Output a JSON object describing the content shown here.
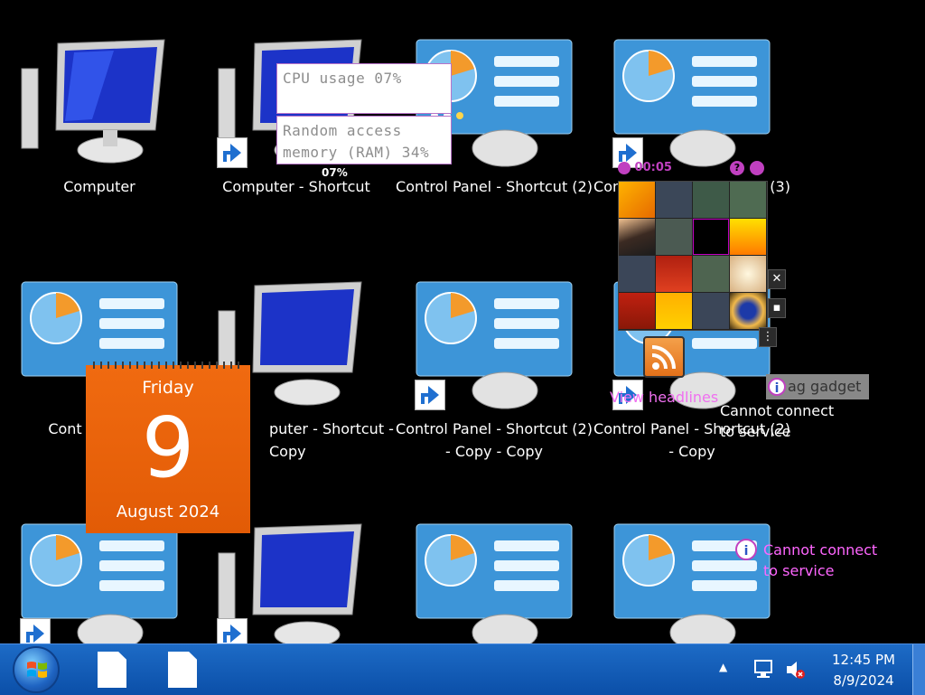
{
  "desktop": {
    "icons": [
      {
        "label": "Computer",
        "kind": "computer",
        "shortcut": false
      },
      {
        "label": "Computer - Shortcut",
        "kind": "computer",
        "shortcut": true
      },
      {
        "label": "Control Panel - Shortcut (2)",
        "kind": "control",
        "shortcut": false
      },
      {
        "label": "Control Panel - Shortcut (3)",
        "kind": "control",
        "shortcut": true
      },
      {
        "label": "Cont",
        "kind": "control",
        "shortcut": false
      },
      {
        "label": "puter - Shortcut - Copy",
        "kind": "computer",
        "shortcut": false
      },
      {
        "label": "Control Panel - Shortcut (2) - Copy - Copy",
        "kind": "control",
        "shortcut": true
      },
      {
        "label": "Control Panel - Shortcut (2) - Copy",
        "kind": "control",
        "shortcut": true
      }
    ]
  },
  "cpu_gadget": {
    "cpu_text": "CPU usage 07%",
    "ram_text_line1": "Random access",
    "ram_text_line2": "memory (RAM) 34%",
    "small_value": "07%"
  },
  "puzzle_gadget": {
    "timer": "00:05"
  },
  "calendar": {
    "weekday": "Friday",
    "day": "9",
    "month_year": "August 2024"
  },
  "feed_gadget": {
    "link_text": "View headlines"
  },
  "weather_gadget_1": {
    "drag_text": "ag gadget",
    "message_line1": "Cannot connect",
    "message_line2": "to service"
  },
  "weather_gadget_2": {
    "message_line1": "Cannot connect",
    "message_line2": "to service"
  },
  "taskbar": {
    "time": "12:45 PM",
    "date": "8/9/2024",
    "tray_arrow": "▲"
  },
  "colors": {
    "taskbar": "#0b4fa8",
    "calendar": "#e25b06",
    "gadget_message": "#ff66ff"
  }
}
